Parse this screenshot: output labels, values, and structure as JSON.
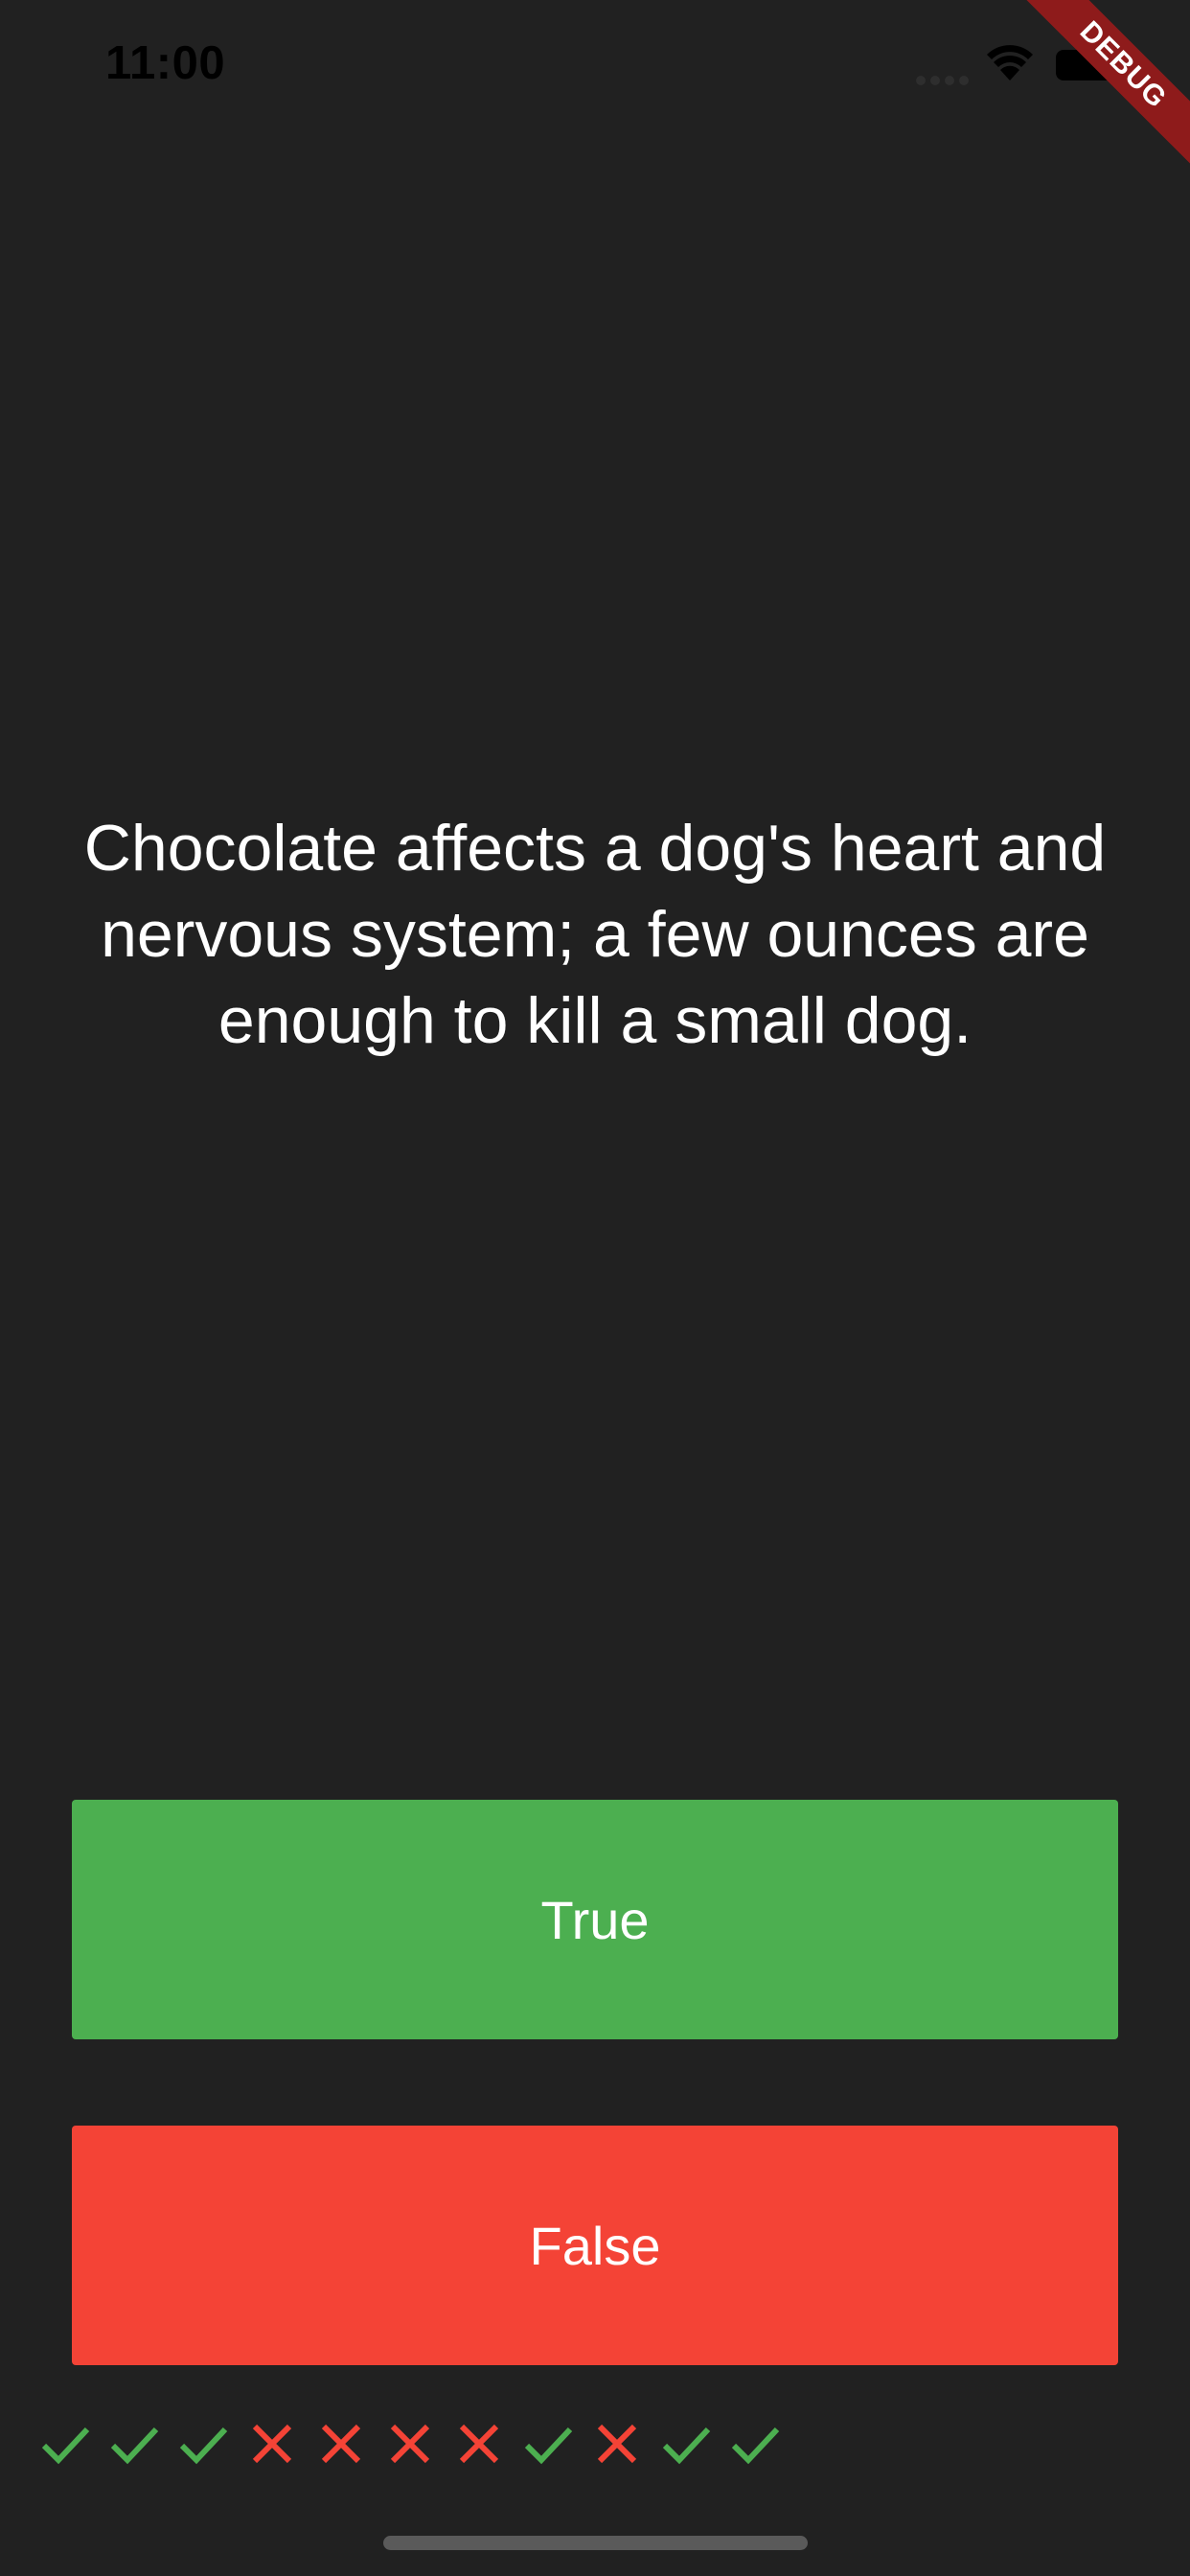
{
  "status_bar": {
    "time": "11:00"
  },
  "debug_banner": {
    "label": "DEBUG"
  },
  "quiz": {
    "question": "Chocolate affects a dog's heart and nervous system; a few ounces are enough to kill a small dog.",
    "true_label": "True",
    "false_label": "False"
  },
  "score": {
    "results": [
      "check",
      "check",
      "check",
      "cross",
      "cross",
      "cross",
      "cross",
      "check",
      "cross",
      "check",
      "check"
    ]
  },
  "colors": {
    "background": "#212121",
    "true": "#4caf50",
    "false": "#f44336"
  }
}
